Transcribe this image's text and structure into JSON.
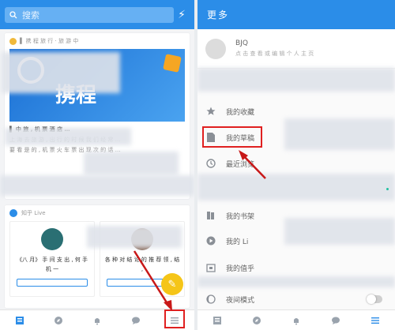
{
  "left": {
    "search_placeholder": "搜索",
    "feed_card_1": {
      "source": "▌ 携 程 旅 行 · 旅 游 中",
      "headline": "▌ 中 旅 , 机 票 酒 店 …",
      "line1": "上 海 去 旅 游 , 出 行 的 时 候 我 们 经 常 …",
      "line2": "要 看 是 的 , 机 票 火 车 票 出 现 次 的 话 …",
      "banner_text": "携程"
    },
    "feed_card_2": {
      "source": "知乎 Live",
      "item1_title": "《八 月》 手 间 支 出 , 何 手 机 一",
      "item2_title": "各 种 对 结 论 的 推 荐 领 , 结 ,"
    },
    "bottom_nav": [
      "home",
      "discover",
      "notifications",
      "messages",
      "more"
    ]
  },
  "right": {
    "header_title": "更多",
    "profile": {
      "name": "BJQ",
      "subtitle": "点 击 查 看 或 编 辑 个 人 主 页"
    },
    "menu": [
      {
        "icon": "star-icon",
        "label": "我的收藏"
      },
      {
        "icon": "draft-icon",
        "label": "我的草稿"
      },
      {
        "icon": "clock-icon",
        "label": "最近浏览"
      },
      {
        "icon": "book-icon",
        "label": "我的书架"
      },
      {
        "icon": "live-icon",
        "label": "我的 Li"
      },
      {
        "icon": "building-icon",
        "label": "我的值乎"
      },
      {
        "icon": "moon-icon",
        "label": "夜间模式"
      }
    ],
    "bottom_nav": [
      "home",
      "discover",
      "notifications",
      "messages",
      "more"
    ]
  },
  "colors": {
    "accent": "#2b8de8",
    "highlight": "#e02020",
    "fab": "#f5c518"
  }
}
